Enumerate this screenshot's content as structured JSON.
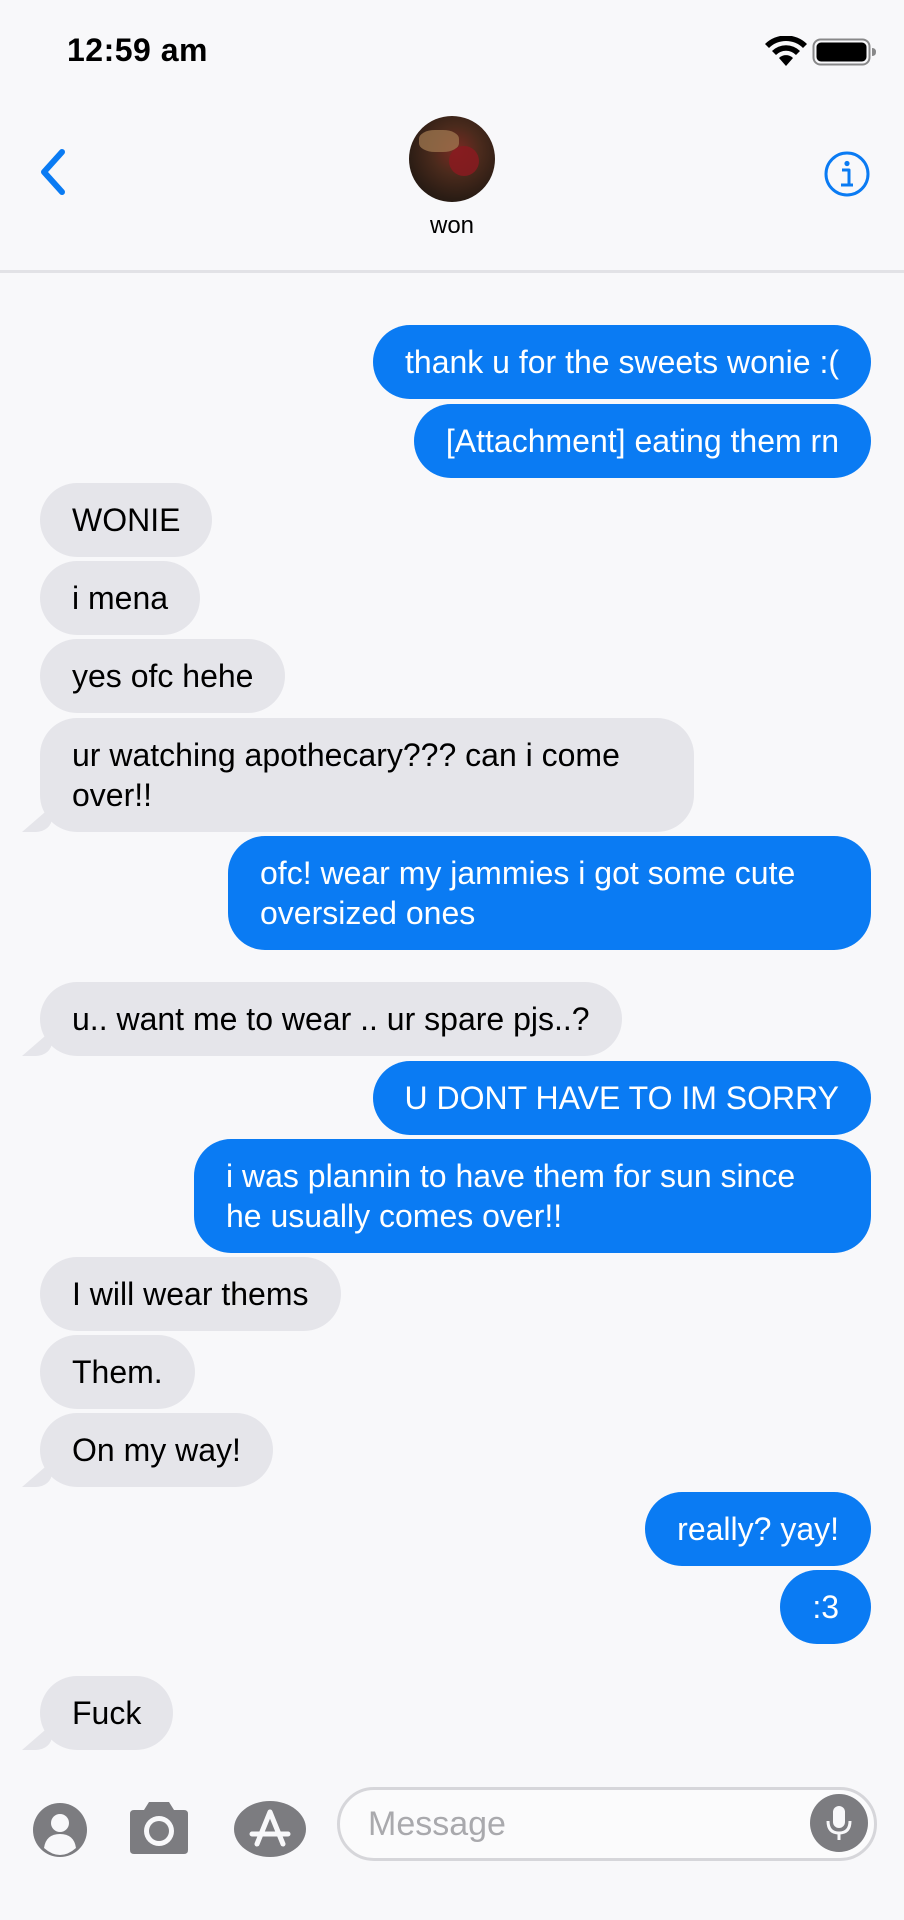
{
  "status_bar": {
    "time": "12:59 am"
  },
  "header": {
    "contact_name": "won",
    "back_icon": "chevron-left-icon",
    "info_icon": "info-icon"
  },
  "messages": [
    {
      "direction": "sent",
      "text": "thank u for the sweets wonie :("
    },
    {
      "direction": "sent",
      "text": "[Attachment] eating them rn"
    },
    {
      "direction": "received",
      "text": "WONIE"
    },
    {
      "direction": "received",
      "text": "i mena"
    },
    {
      "direction": "received",
      "text": "yes ofc hehe"
    },
    {
      "direction": "received",
      "text": "ur watching apothecary??? can i come over!!"
    },
    {
      "direction": "sent",
      "text": "ofc! wear my jammies i got some cute oversized ones"
    },
    {
      "direction": "received",
      "text": "u.. want me to wear .. ur spare pjs..?"
    },
    {
      "direction": "sent",
      "text": "U DONT HAVE TO IM SORRY"
    },
    {
      "direction": "sent",
      "text": "i was plannin to have them for sun since he usually comes over!!"
    },
    {
      "direction": "received",
      "text": "I will wear thems"
    },
    {
      "direction": "received",
      "text": "Them."
    },
    {
      "direction": "received",
      "text": "On my way!"
    },
    {
      "direction": "sent",
      "text": "really? yay!"
    },
    {
      "direction": "sent",
      "text": ":3"
    },
    {
      "direction": "received",
      "text": "Fuck"
    }
  ],
  "input_bar": {
    "placeholder": "Message",
    "value": ""
  },
  "colors": {
    "sent_bubble": "#0a7bf3",
    "received_bubble": "#e5e5ea",
    "accent": "#0a7bf3"
  }
}
